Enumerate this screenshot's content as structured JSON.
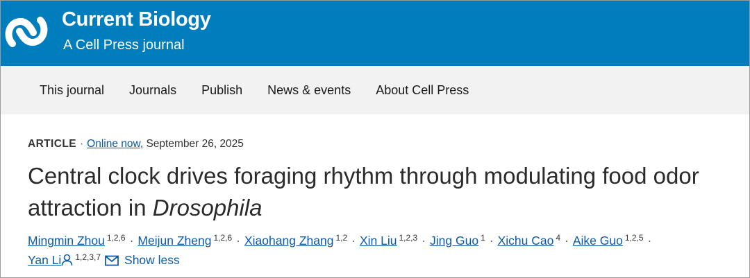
{
  "header": {
    "journal_title": "Current Biology",
    "journal_subtitle": "A Cell Press journal",
    "logo_icon": "cell-press-logo-icon",
    "background_color": "#007dbc"
  },
  "nav": {
    "items": [
      {
        "label": "This journal"
      },
      {
        "label": "Journals"
      },
      {
        "label": "Publish"
      },
      {
        "label": "News & events"
      },
      {
        "label": "About Cell Press"
      }
    ]
  },
  "article": {
    "type": "ARTICLE",
    "separator": "·",
    "status_link": "Online now",
    "date": ", September 26, 2025",
    "title_main": "Central clock drives foraging rhythm through modulating food odor attraction in ",
    "title_italic": "Drosophila",
    "authors": [
      {
        "name": "Mingmin Zhou",
        "affil": "1,2,6"
      },
      {
        "name": "Meijun Zheng",
        "affil": "1,2,6"
      },
      {
        "name": "Xiaohang Zhang",
        "affil": "1,2"
      },
      {
        "name": "Xin Liu",
        "affil": "1,2,3"
      },
      {
        "name": "Jing Guo",
        "affil": "1"
      },
      {
        "name": "Xichu Cao",
        "affil": "4"
      },
      {
        "name": "Aike Guo",
        "affil": "1,2,5"
      },
      {
        "name": "Yan Li",
        "affil": "1,2,3,7"
      }
    ],
    "dot": "·",
    "show_less": "Show less",
    "corresponding_icon": "person-icon",
    "email_icon": "envelope-icon",
    "link_color": "#0c5aa6"
  }
}
